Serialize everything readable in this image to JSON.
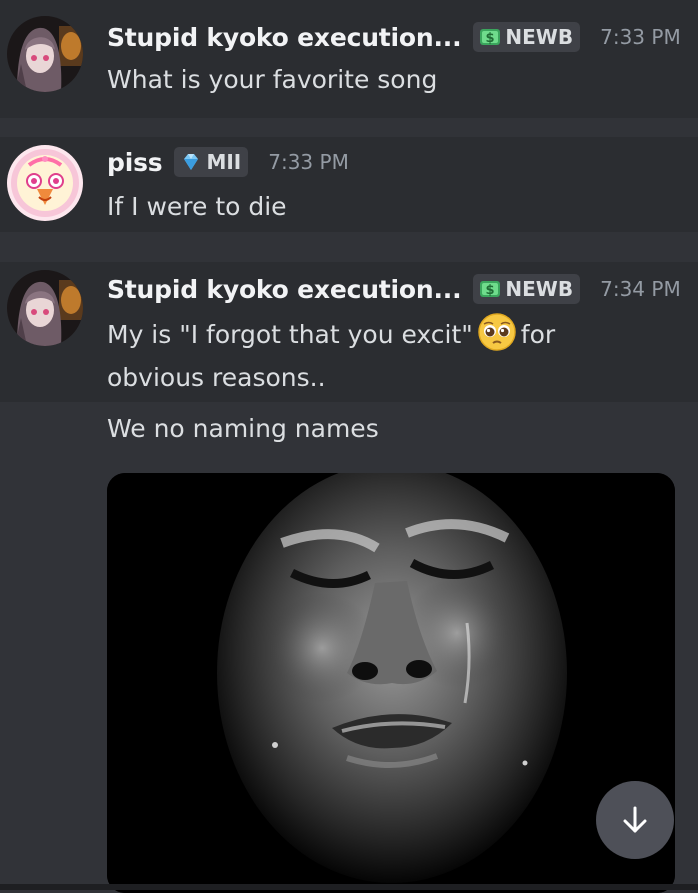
{
  "messages": [
    {
      "username": "Stupid kyoko execution...",
      "tag": "NEWB",
      "tag_icon": "dollar-icon",
      "time": "7:33 PM",
      "text": "What is your favorite song"
    },
    {
      "username": "piss",
      "tag": "MII",
      "tag_icon": "diamond-icon",
      "time": "7:33 PM",
      "text": "If I were to die"
    },
    {
      "username": "Stupid kyoko execution...",
      "tag": "NEWB",
      "tag_icon": "dollar-icon",
      "time": "7:34 PM",
      "text_part1": "My is \"I forgot that you excit\"",
      "emoji": "pleading-face-emoji",
      "text_part2": "for",
      "text_line2": "obvious reasons..",
      "followup": "We no naming names"
    }
  ],
  "colors": {
    "background": "#313338",
    "highlight": "#2b2d31",
    "username": "#f2f3f5",
    "text": "#dbdee1",
    "timestamp": "#949ba4",
    "tag_bg": "#3f4147"
  },
  "embed": {
    "type": "image",
    "icon": "crying-face-image"
  },
  "scroll_button": {
    "icon": "arrow-down-icon"
  }
}
